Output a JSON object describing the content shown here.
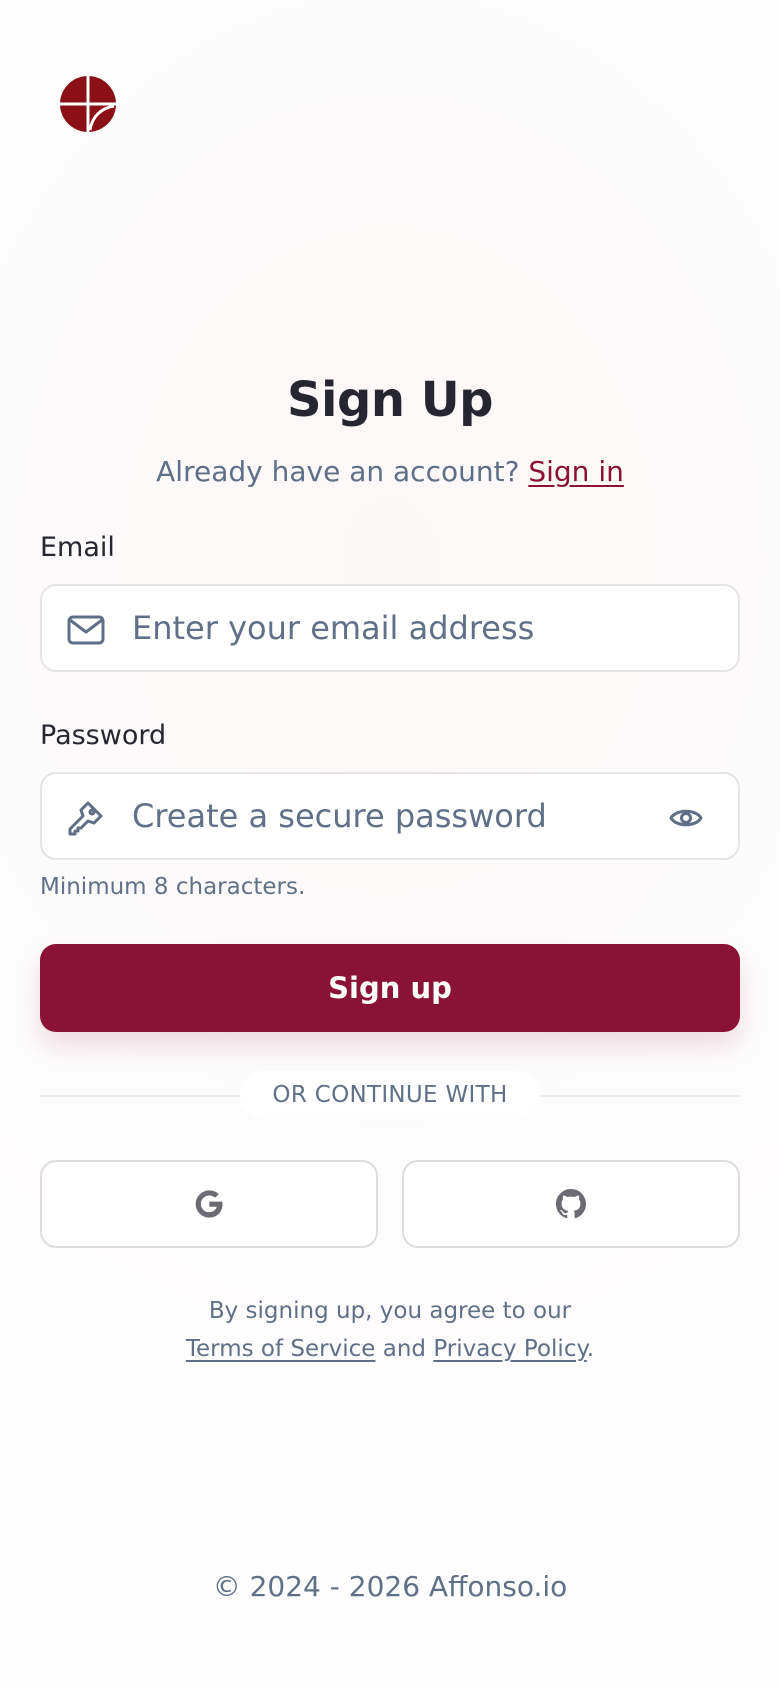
{
  "brand": {
    "accent": "#8a1236",
    "logo_color": "#8a0f16",
    "icon": "quartered-circle-logo-icon"
  },
  "header": {
    "title": "Sign Up",
    "subtitle_prefix": "Already have an account?",
    "signin_link": "Sign in"
  },
  "form": {
    "email": {
      "label": "Email",
      "placeholder": "Enter your email address",
      "value": "",
      "icon": "mail-icon"
    },
    "password": {
      "label": "Password",
      "placeholder": "Create a secure password",
      "value": "",
      "icon": "key-icon",
      "toggle_icon": "eye-icon",
      "hint": "Minimum 8 characters."
    },
    "submit_label": "Sign up"
  },
  "social": {
    "divider_label": "OR CONTINUE WITH",
    "providers": [
      {
        "name": "Google",
        "icon": "google-icon"
      },
      {
        "name": "GitHub",
        "icon": "github-icon"
      }
    ]
  },
  "legal": {
    "prefix": "By signing up, you agree to our",
    "terms_link": "Terms of Service",
    "connector": "and",
    "privacy_link": "Privacy Policy",
    "suffix": "."
  },
  "footer": {
    "copyright": "© 2024 - 2026 Affonso.io"
  }
}
